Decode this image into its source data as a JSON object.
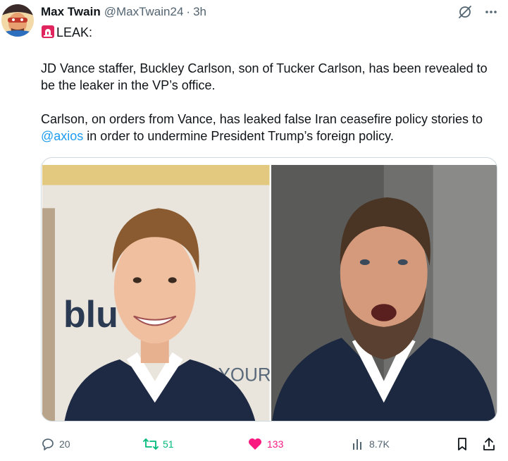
{
  "author": {
    "display_name": "Max Twain",
    "handle": "@MaxTwain24",
    "separator": "·",
    "time": "3h"
  },
  "tweet": {
    "lead_emoji": "rotating-light-icon",
    "lead_text": "LEAK:",
    "paragraph_1": "JD Vance staffer, Buckley Carlson, son of Tucker Carlson, has been revealed to be the leaker in the VP’s office.",
    "paragraph_2_start": "Carlson, on orders from Vance, has leaked false Iran ceasefire policy stories to ",
    "mention": "@axios",
    "paragraph_2_end": " in order to undermine President Trump’s foreign policy."
  },
  "media": {
    "left_photo_sign": "blu    nre",
    "left_photo_sign_small": "YOURST"
  },
  "actions": {
    "replies": "20",
    "retweets": "51",
    "likes": "133",
    "views": "8.7K"
  },
  "colors": {
    "accent": "#1d9bf0",
    "retweet": "#00ba7c",
    "like": "#f91880",
    "secondary_text": "#536471"
  }
}
